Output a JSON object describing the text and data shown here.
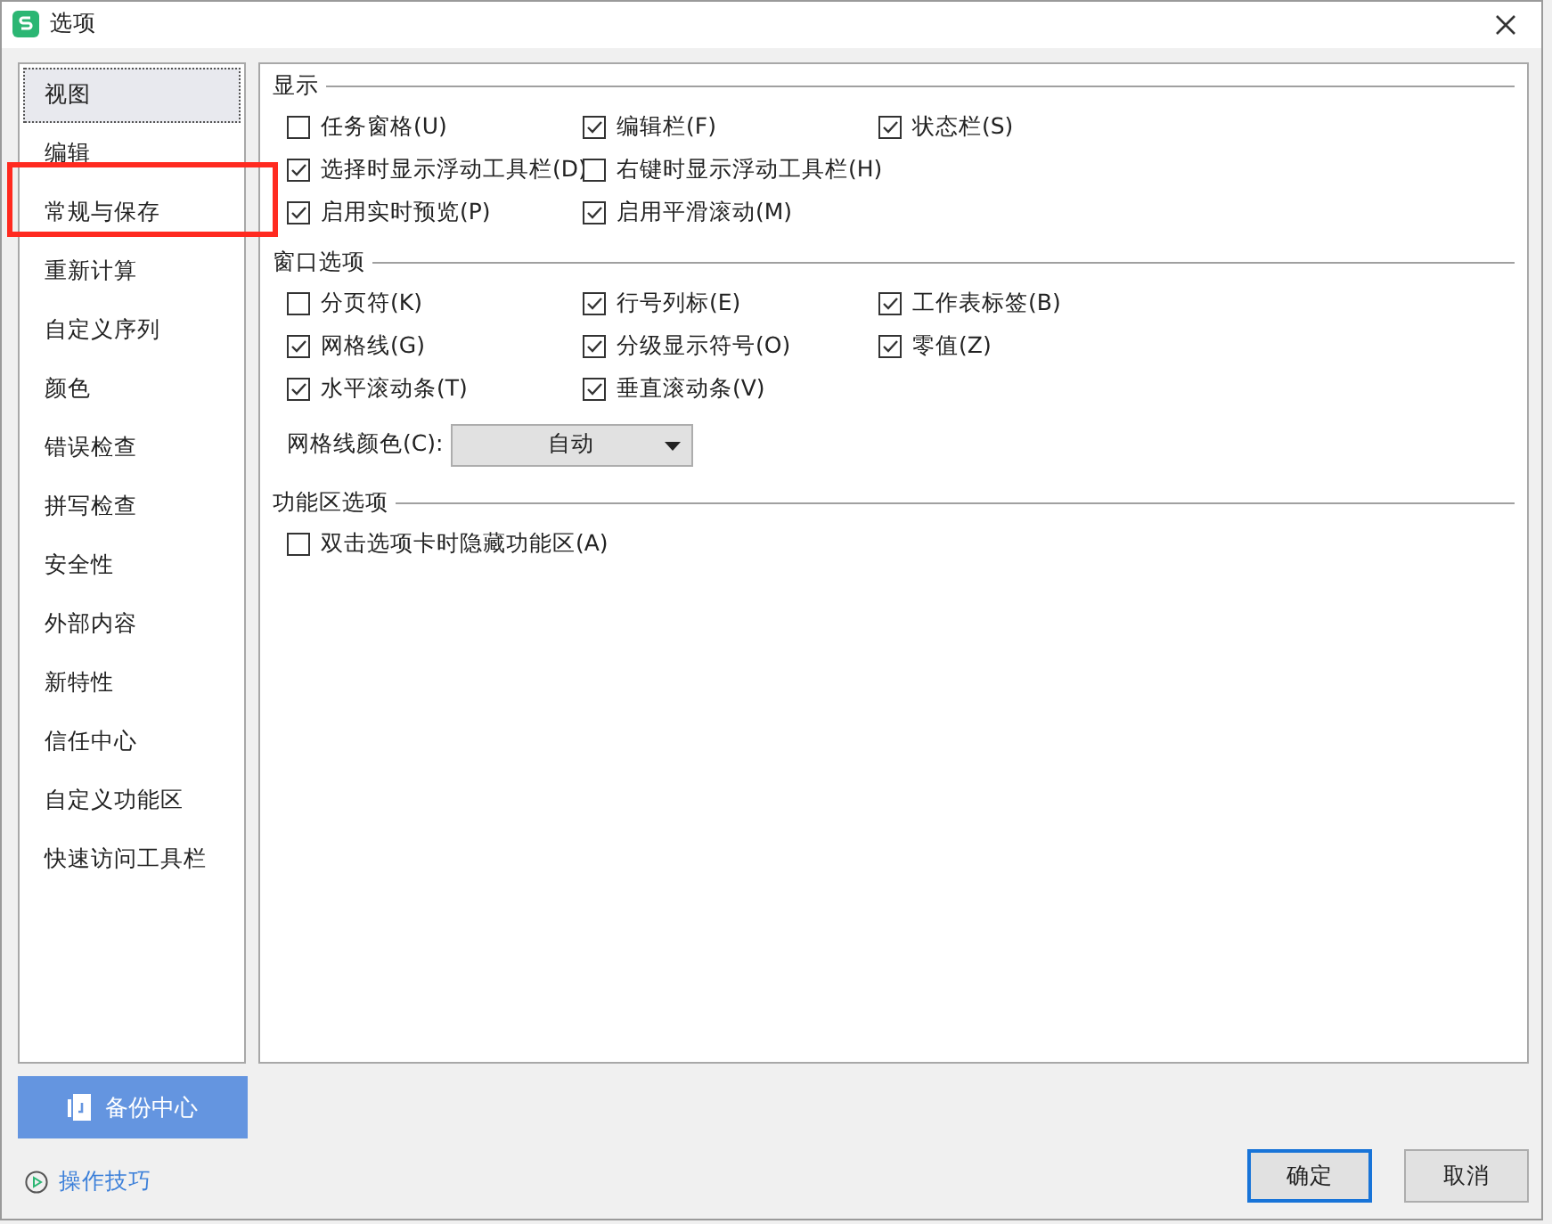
{
  "window": {
    "title": "选项"
  },
  "sidebar": {
    "items": [
      {
        "label": "视图",
        "selected": true,
        "highlighted": false
      },
      {
        "label": "编辑",
        "selected": false,
        "highlighted": false
      },
      {
        "label": "常规与保存",
        "selected": false,
        "highlighted": true
      },
      {
        "label": "重新计算",
        "selected": false,
        "highlighted": false
      },
      {
        "label": "自定义序列",
        "selected": false,
        "highlighted": false
      },
      {
        "label": "颜色",
        "selected": false,
        "highlighted": false
      },
      {
        "label": "错误检查",
        "selected": false,
        "highlighted": false
      },
      {
        "label": "拼写检查",
        "selected": false,
        "highlighted": false
      },
      {
        "label": "安全性",
        "selected": false,
        "highlighted": false
      },
      {
        "label": "外部内容",
        "selected": false,
        "highlighted": false
      },
      {
        "label": "新特性",
        "selected": false,
        "highlighted": false
      },
      {
        "label": "信任中心",
        "selected": false,
        "highlighted": false
      },
      {
        "label": "自定义功能区",
        "selected": false,
        "highlighted": false
      },
      {
        "label": "快速访问工具栏",
        "selected": false,
        "highlighted": false
      }
    ],
    "backup_button": "备份中心",
    "tips_link": "操作技巧"
  },
  "sections": [
    {
      "title": "显示",
      "rows": [
        [
          {
            "label": "任务窗格(U)",
            "checked": false
          },
          {
            "label": "编辑栏(F)",
            "checked": true
          },
          {
            "label": "状态栏(S)",
            "checked": true
          }
        ],
        [
          {
            "label": "选择时显示浮动工具栏(D)",
            "checked": true
          },
          {
            "label": "右键时显示浮动工具栏(H)",
            "checked": false
          }
        ],
        [
          {
            "label": "启用实时预览(P)",
            "checked": true
          },
          {
            "label": "启用平滑滚动(M)",
            "checked": true
          }
        ]
      ]
    },
    {
      "title": "窗口选项",
      "rows": [
        [
          {
            "label": "分页符(K)",
            "checked": false
          },
          {
            "label": "行号列标(E)",
            "checked": true
          },
          {
            "label": "工作表标签(B)",
            "checked": true
          }
        ],
        [
          {
            "label": "网格线(G)",
            "checked": true
          },
          {
            "label": "分级显示符号(O)",
            "checked": true
          },
          {
            "label": "零值(Z)",
            "checked": true
          }
        ],
        [
          {
            "label": "水平滚动条(T)",
            "checked": true
          },
          {
            "label": "垂直滚动条(V)",
            "checked": true
          }
        ]
      ],
      "dropdown": {
        "label": "网格线颜色(C):",
        "value": "自动"
      }
    },
    {
      "title": "功能区选项",
      "rows": [
        [
          {
            "label": "双击选项卡时隐藏功能区(A)",
            "checked": false
          }
        ]
      ]
    }
  ],
  "buttons": [
    {
      "label": "确定",
      "default": true
    },
    {
      "label": "取消",
      "default": false
    }
  ]
}
